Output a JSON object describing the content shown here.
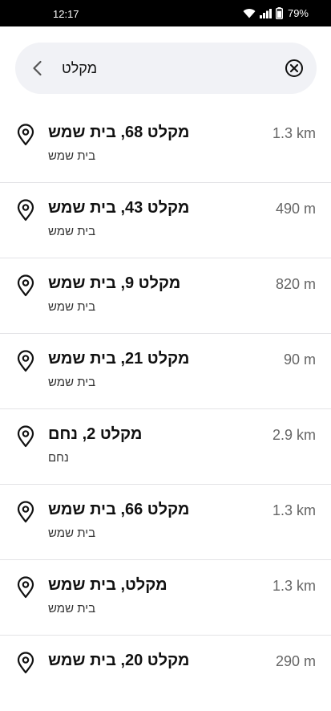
{
  "status_bar": {
    "time": "12:17",
    "battery": "79%"
  },
  "search": {
    "query": "מקלט"
  },
  "results": [
    {
      "title": "מקלט 68, בית שמש",
      "subtitle": "בית שמש",
      "distance": "1.3 km"
    },
    {
      "title": "מקלט 43, בית שמש",
      "subtitle": "בית שמש",
      "distance": "490 m"
    },
    {
      "title": "מקלט 9, בית שמש",
      "subtitle": "בית שמש",
      "distance": "820 m"
    },
    {
      "title": "מקלט 21, בית שמש",
      "subtitle": "בית שמש",
      "distance": "90 m"
    },
    {
      "title": "מקלט 2, נחם",
      "subtitle": "נחם",
      "distance": "2.9 km"
    },
    {
      "title": "מקלט 66, בית שמש",
      "subtitle": "בית שמש",
      "distance": "1.3 km"
    },
    {
      "title": "מקלט, בית שמש",
      "subtitle": "בית שמש",
      "distance": "1.3 km"
    },
    {
      "title": "מקלט 20, בית שמש",
      "subtitle": "",
      "distance": "290 m"
    }
  ]
}
